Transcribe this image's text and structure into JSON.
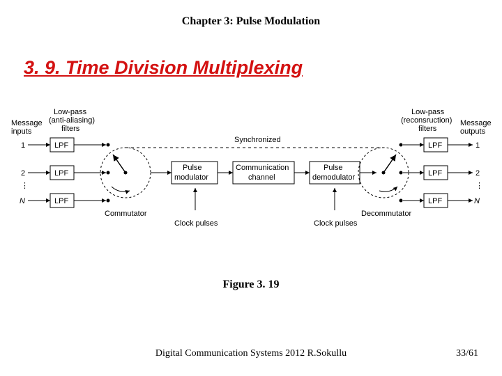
{
  "chapter": "Chapter 3: Pulse Modulation",
  "section_title": "3. 9. Time Division Multiplexing",
  "caption": "Figure 3. 19",
  "footer_left": "Digital Communication Systems 2012 R.Sokullu",
  "footer_right": "33/61",
  "diagram": {
    "left_label_top": "Message",
    "left_label_bottom": "inputs",
    "left_filter_top": "Low-pass",
    "left_filter_mid": "(anti-aliasing)",
    "left_filter_bot": "filters",
    "right_label_top": "Message",
    "right_label_bottom": "outputs",
    "right_filter_top": "Low-pass",
    "right_filter_mid": "(reconsruction)",
    "right_filter_bot": "filters",
    "idx1": "1",
    "idx2": "2",
    "idxN": "N",
    "lpf": "LPF",
    "commutator": "Commutator",
    "decommutator": "Decommutator",
    "pulse_mod_top": "Pulse",
    "pulse_mod_bot": "modulator",
    "channel_top": "Communication",
    "channel_bot": "channel",
    "pulse_demod_top": "Pulse",
    "pulse_demod_bot": "demodulator",
    "synchronized": "Synchronized",
    "clock": "Clock pulses"
  }
}
